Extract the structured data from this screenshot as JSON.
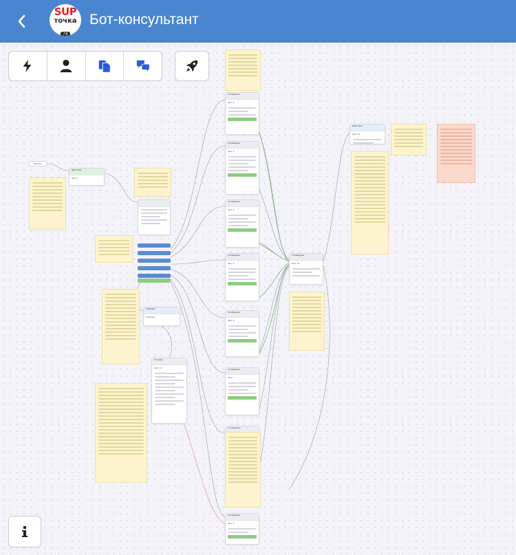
{
  "header": {
    "title": "Бот-консультант",
    "logo": {
      "brand": "SUP",
      "name": "точка",
      "number": "78"
    }
  },
  "toolbar": {
    "buttons": [
      {
        "icon": "lightning-icon"
      },
      {
        "icon": "person-icon"
      },
      {
        "icon": "copy-icon"
      },
      {
        "icon": "chat-bubbles-icon"
      }
    ],
    "launch_icon": "rocket-icon"
  },
  "info_icon": "info-icon",
  "flow": {
    "start_label": "Начало",
    "nodes": [
      {
        "header": "Действие",
        "body": "Шаг 1"
      },
      {
        "header": "Сообщение",
        "body": "Шаг 2"
      },
      {
        "header": "Сообщение",
        "body": "Шаг 3"
      },
      {
        "header": "Сообщение",
        "body": "Шаг 4"
      },
      {
        "header": "Сообщение",
        "body": "Шаг 5"
      },
      {
        "header": "Сообщение",
        "body": "Шаг 6"
      },
      {
        "header": "Сообщение",
        "body": "Шаг 7"
      },
      {
        "header": "Сообщение",
        "body": "Шаг 8"
      },
      {
        "header": "Сообщение",
        "body": "Шаг 9"
      },
      {
        "header": "Сообщение",
        "body": "Шаг 10"
      },
      {
        "header": "Сообщение",
        "body": "Шаг 11"
      },
      {
        "header": "Сообщение",
        "body": "Шаг 12"
      },
      {
        "header": "Таблица",
        "body": "Таблица"
      },
      {
        "header": "Условие",
        "body": "Шаг 13"
      },
      {
        "header": "Действие",
        "body": "Шаг 14"
      }
    ]
  },
  "colors": {
    "header": "#4a86d0",
    "canvas": "#f3f3f9",
    "note": "#fdf4cf",
    "warning_note": "#fbd9cc",
    "node_header": "#dff2df",
    "button_pill": "#5a8bd3",
    "green_bar": "#8ecc82"
  }
}
